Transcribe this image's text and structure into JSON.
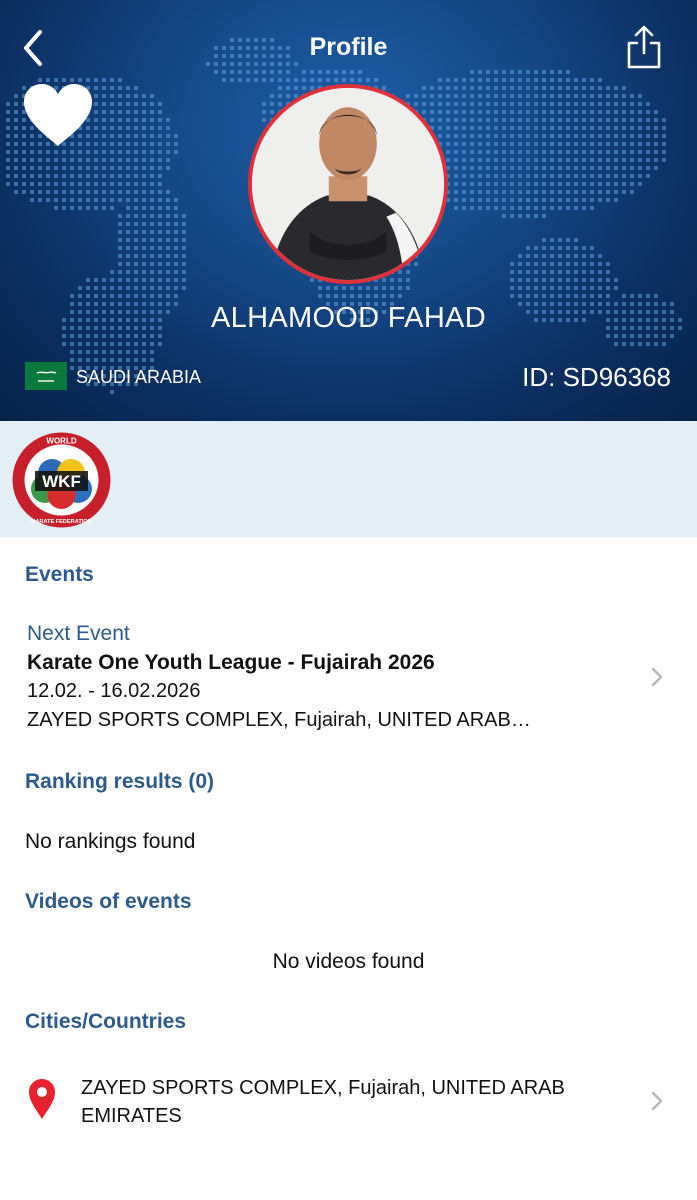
{
  "header": {
    "title": "Profile",
    "back_icon": "chevron-left-icon",
    "share_icon": "share-icon",
    "favorite_icon": "heart-icon"
  },
  "athlete": {
    "name": "ALHAMOOD FAHAD",
    "country": "SAUDI ARABIA",
    "id_label": "ID: SD96368",
    "flag_icon": "saudi-arabia-flag-icon"
  },
  "federation": {
    "logo_text_top": "WORLD",
    "logo_text_center": "WKF",
    "logo_text_bottom": "KARATE FEDERATION"
  },
  "events": {
    "section_title": "Events",
    "next_label": "Next Event",
    "event_name": "Karate One Youth League - Fujairah 2026",
    "dates": "12.02. - 16.02.2026",
    "venue": "ZAYED SPORTS COMPLEX, Fujairah, UNITED ARAB…"
  },
  "rankings": {
    "section_title": "Ranking results (0)",
    "empty_text": "No rankings found"
  },
  "videos": {
    "section_title": "Videos of events",
    "empty_text": "No videos found"
  },
  "cities": {
    "section_title": "Cities/Countries",
    "items": [
      {
        "text": "ZAYED SPORTS COMPLEX, Fujairah, UNITED ARAB EMIRATES",
        "icon": "location-pin-icon"
      }
    ]
  },
  "colors": {
    "header_blue": "#154a8a",
    "section_title_blue": "#2c5a8c",
    "avatar_border_red": "#e0303a",
    "band_light_blue": "#e3eef5",
    "pin_red": "#e8212e"
  }
}
